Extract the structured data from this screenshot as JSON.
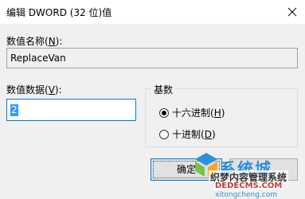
{
  "window": {
    "title": "编辑 DWORD (32 位)值",
    "close_icon": "close-icon"
  },
  "value_name": {
    "label": "数值名称(",
    "accel": "N",
    "label_tail": "):",
    "value": "ReplaceVan"
  },
  "value_data": {
    "label": "数值数据(",
    "accel": "V",
    "label_tail": "):",
    "value": "2"
  },
  "base": {
    "title": "基数",
    "options": [
      {
        "label": "十六进制(",
        "accel": "H",
        "tail": ")",
        "selected": true
      },
      {
        "label": "十进制(",
        "accel": "D",
        "tail": ")",
        "selected": false
      }
    ]
  },
  "buttons": {
    "ok_label": "确定"
  },
  "watermark": {
    "brand": "系统城",
    "cn_text": "织梦内容管理系统",
    "en_text": "DEDECMS.COM",
    "url": "xitongcheng.com"
  },
  "colors": {
    "accent": "#0078d7",
    "selection": "#3399ff",
    "dialog_bg": "#f0f0f0"
  }
}
